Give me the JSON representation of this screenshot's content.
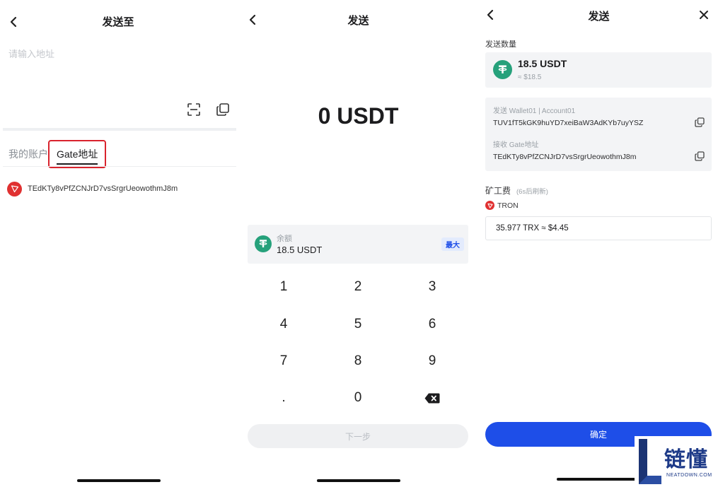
{
  "screen1": {
    "title": "发送至",
    "address_placeholder": "请输入地址",
    "tabs": [
      {
        "label": "我的账户"
      },
      {
        "label": "Gate地址"
      }
    ],
    "saved_address": "TEdKTy8vPfZCNJrD7vsSrgrUeowothmJ8m"
  },
  "screen2": {
    "title": "发送",
    "amount": "0 USDT",
    "balance_label": "余额",
    "balance_value": "18.5 USDT",
    "max_label": "最大",
    "keys": [
      "1",
      "2",
      "3",
      "4",
      "5",
      "6",
      "7",
      "8",
      "9",
      ".",
      "0"
    ],
    "next_label": "下一步"
  },
  "screen3": {
    "title": "发送",
    "send_amount_label": "发送数量",
    "amount": "18.5 USDT",
    "amount_fiat": "≈ $18.5",
    "from_label": "发送 Wallet01 | Account01",
    "from_address": "TUV1fT5kGK9huYD7xeiBaW3AdKYb7uyYSZ",
    "to_label": "接收 Gate地址",
    "to_address": "TEdKTy8vPfZCNJrD7vsSrgrUeowothmJ8m",
    "fee_label": "矿工费",
    "fee_refresh": "(6s后刷新)",
    "network": "TRON",
    "fee_value": "35.977 TRX ≈ $4.45",
    "confirm_label": "确定"
  },
  "watermark": {
    "text": "链懂",
    "sub": "NEATDOWN.COM"
  },
  "colors": {
    "accent_blue": "#1e4ee8",
    "usdt_green": "#26a17b",
    "tron_red": "#e03131",
    "highlight_red": "#d9232d"
  }
}
